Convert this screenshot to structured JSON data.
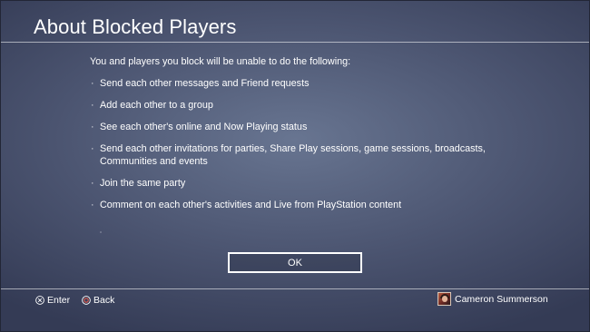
{
  "dialog": {
    "title": "About Blocked Players",
    "intro": "You and players you block will be unable to do the following:",
    "bullet_marker": "·",
    "items": [
      "Send each other messages and Friend requests",
      "Add each other to a group",
      "See each other's online and Now Playing status",
      "Send each other invitations for parties, Share Play sessions, game sessions, broadcasts, Communities and events",
      "Join the same party",
      "Comment on each other's activities and Live from PlayStation content"
    ],
    "ok_label": "OK"
  },
  "footer": {
    "enter": {
      "icon": "cross-button-icon",
      "label": "Enter"
    },
    "back": {
      "icon": "circle-button-icon",
      "label": "Back",
      "color": "#e05a4c"
    },
    "user": {
      "icon": "avatar",
      "name": "Cameron Summerson"
    }
  },
  "colors": {
    "background": "#4b5470",
    "background_edge": "#343b55",
    "text": "#ffffff",
    "rule": "#ffffff"
  }
}
